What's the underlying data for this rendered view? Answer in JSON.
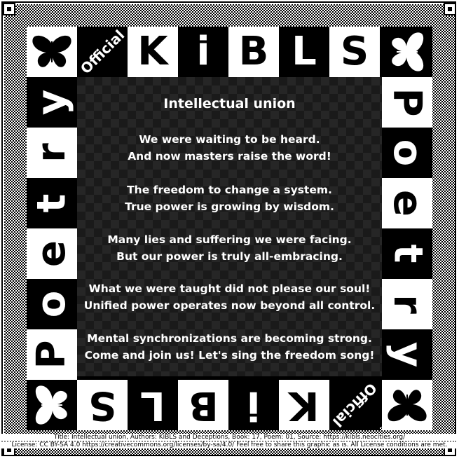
{
  "border": {
    "top_letters": [
      "K",
      "i",
      "B",
      "L",
      "S"
    ],
    "bottom_letters": [
      "S",
      "L",
      "B",
      "i",
      "K"
    ],
    "side_word_letters": [
      "P",
      "o",
      "e",
      "t",
      "r",
      "y"
    ],
    "official_label": "Official"
  },
  "poem": {
    "title": "Intellectual union",
    "lines": [
      "We were waiting to be heard.",
      "And now masters raise the word!",
      "The freedom to change a system.",
      "True power is growing by wisdom.",
      "Many lies and suffering we were facing.",
      "But our power is truly all-embracing.",
      "What we were taught did not please our soul!",
      "Unified power operates now beyond all control.",
      "Mental synchronizations are becoming strong.",
      "Come and join us! Let's sing the freedom song!"
    ]
  },
  "footer": {
    "line1": "Title: Intellectual union, Authors: KiBLS and Deceptions, Book: 17, Poem: 01, Source: https://kibls.neocities.org/",
    "line2": "License: CC BY-SA 4.0 https://creativecommons.org/licenses/by-sa/4.0/ Feel free to share this graphic as is. All License conditions are met."
  },
  "colors": {
    "background": "#ffffff",
    "foreground": "#000000"
  }
}
